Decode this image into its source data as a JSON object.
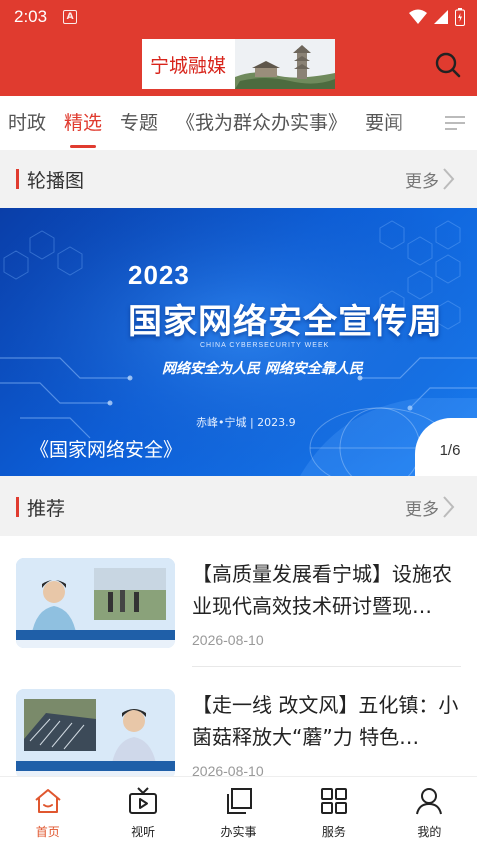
{
  "status_bar": {
    "time": "2:03",
    "app_badge": "A"
  },
  "header": {
    "logo_text": "宁城融媒"
  },
  "tabs": [
    {
      "label": "时政"
    },
    {
      "label": "精选"
    },
    {
      "label": "专题"
    },
    {
      "label": "《我为群众办实事》"
    },
    {
      "label": "要闻"
    }
  ],
  "active_tab": "精选",
  "carousel_section": {
    "title": "轮播图",
    "more": "更多"
  },
  "carousel": {
    "banner_year": "2023",
    "banner_title": "国家网络安全宣传周",
    "banner_subtitle_en": "CHINA CYBERSECURITY WEEK",
    "banner_slogan": "网络安全为人民  网络安全靠人民",
    "banner_place": "赤峰•宁城 | 2023.9",
    "caption": "《国家网络安全》",
    "counter": "1/6"
  },
  "recommend_section": {
    "title": "推荐",
    "more": "更多"
  },
  "news": [
    {
      "title": "【高质量发展看宁城】设施农业现代高效技术研讨暨现…",
      "date": "2026-08-10"
    },
    {
      "title": "【走一线  改文风】五化镇：小菌菇释放大“蘑”力  特色…",
      "date": "2026-08-10"
    }
  ],
  "bottom_nav": [
    {
      "label": "首页",
      "icon": "home-icon"
    },
    {
      "label": "视听",
      "icon": "video-icon"
    },
    {
      "label": "办实事",
      "icon": "copy-icon"
    },
    {
      "label": "服务",
      "icon": "grid-icon"
    },
    {
      "label": "我的",
      "icon": "user-icon"
    }
  ],
  "colors": {
    "brand": "#e03b2f",
    "active_nav": "#e0572f",
    "banner": "#0d5fd8"
  }
}
